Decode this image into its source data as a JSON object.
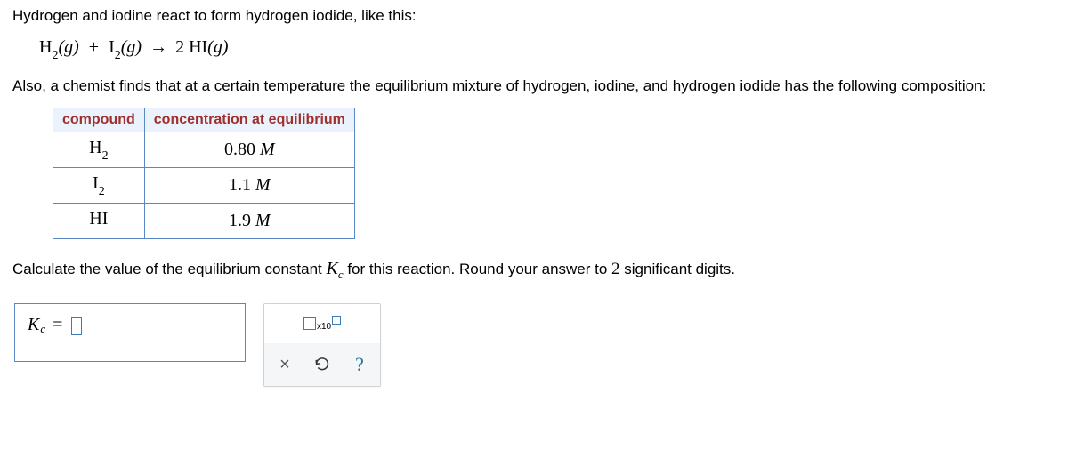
{
  "intro_text": "Hydrogen and iodine react to form hydrogen iodide, like this:",
  "equation": {
    "r1_base": "H",
    "r1_sub": "2",
    "r1_state": "(g)",
    "plus": "+",
    "r2_base": "I",
    "r2_sub": "2",
    "r2_state": "(g)",
    "arrow": "→",
    "p_coef": "2",
    "p_base": "HI",
    "p_state": "(g)"
  },
  "second_text": "Also, a chemist finds that at a certain temperature the equilibrium mixture of hydrogen, iodine, and hydrogen iodide has the following composition:",
  "table": {
    "header_compound": "compound",
    "header_conc": "concentration at equilibrium",
    "rows": [
      {
        "c_base": "H",
        "c_sub": "2",
        "value": "0.80",
        "unit": "M"
      },
      {
        "c_base": "I",
        "c_sub": "2",
        "value": "1.1",
        "unit": "M"
      },
      {
        "c_base": "HI",
        "c_sub": "",
        "value": "1.9",
        "unit": "M"
      }
    ]
  },
  "question_prefix": "Calculate the value of the equilibrium constant ",
  "kc_K": "K",
  "kc_sub": "c",
  "question_suffix": " for this reaction. Round your answer to ",
  "sigdigits": "2",
  "question_tail": " significant digits.",
  "answer": {
    "K": "K",
    "sub": "c",
    "eq": "="
  },
  "toolbar": {
    "sci_x10": "x10",
    "clear": "×",
    "help": "?"
  }
}
